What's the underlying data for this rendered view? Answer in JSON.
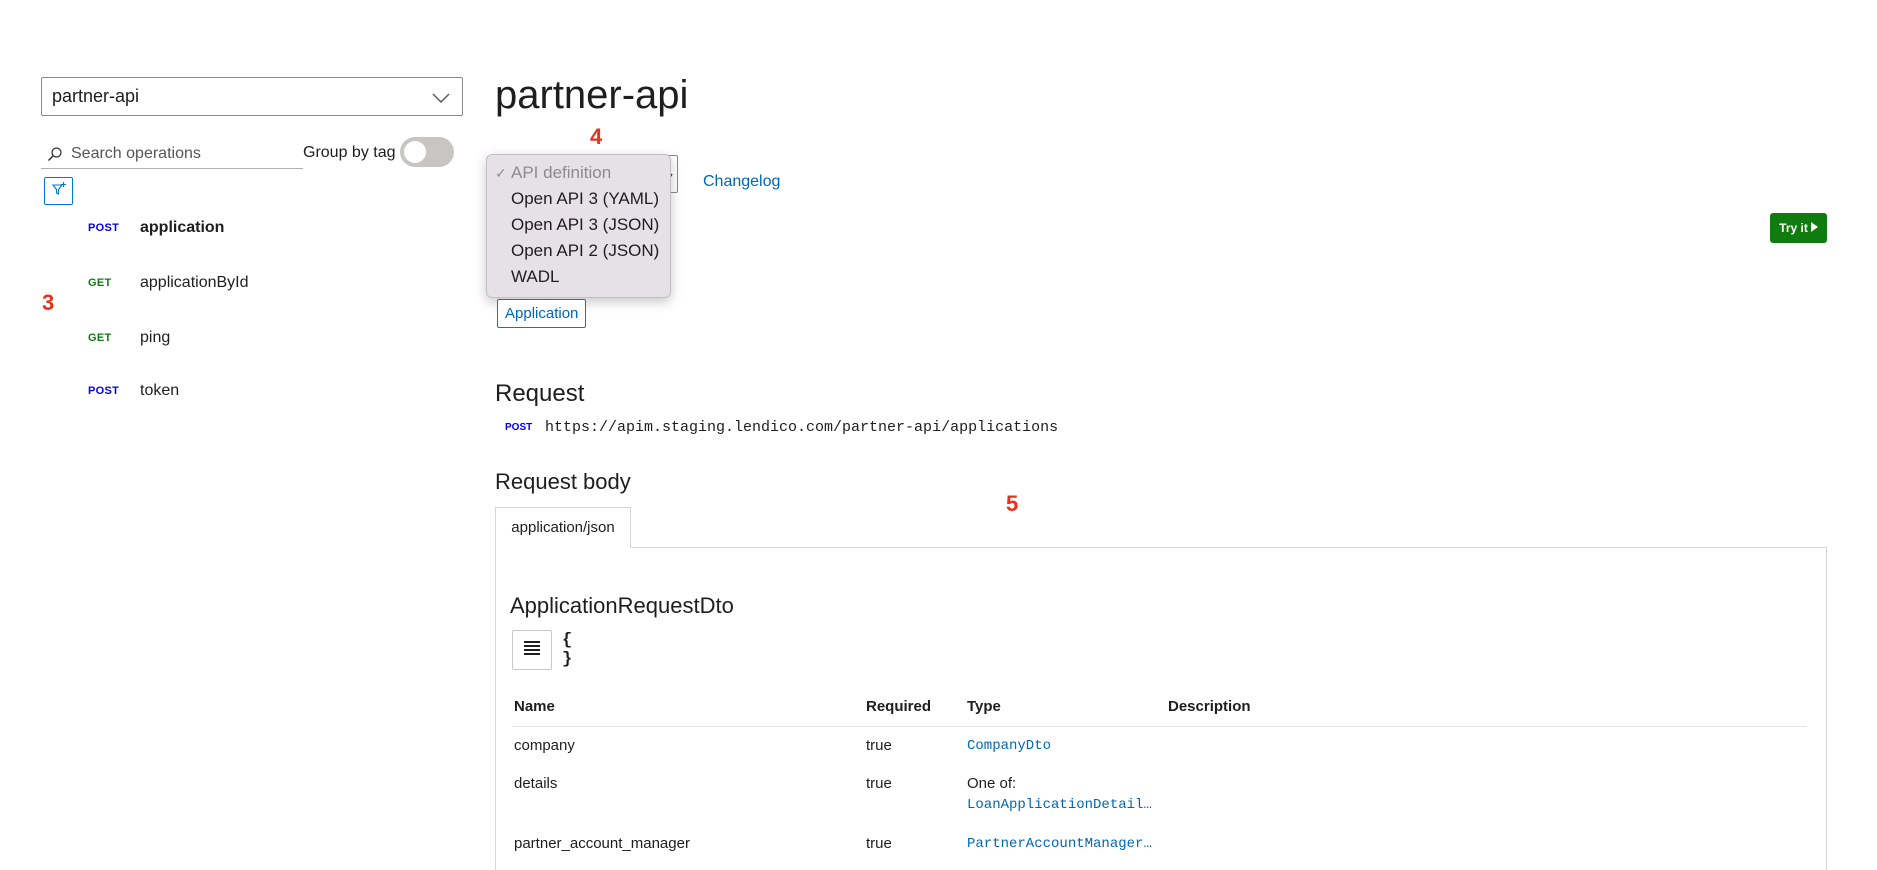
{
  "sidebar": {
    "api_select": {
      "value": "partner-api"
    },
    "search": {
      "placeholder": "Search operations"
    },
    "group_by_tag": {
      "label": "Group by tag",
      "enabled": false
    },
    "operations": [
      {
        "method": "POST",
        "name": "application",
        "active": true
      },
      {
        "method": "GET",
        "name": "applicationById",
        "active": false
      },
      {
        "method": "GET",
        "name": "ping",
        "active": false
      },
      {
        "method": "POST",
        "name": "token",
        "active": false
      }
    ]
  },
  "annotations": {
    "sidebar": "3",
    "dropdown": "4",
    "body": "5"
  },
  "main": {
    "title": "partner-api",
    "definition_dropdown": {
      "options": [
        {
          "label": "API definition",
          "selected": true
        },
        {
          "label": "Open API 3 (YAML)",
          "selected": false
        },
        {
          "label": "Open API 3 (JSON)",
          "selected": false
        },
        {
          "label": "Open API 2 (JSON)",
          "selected": false
        },
        {
          "label": "WADL",
          "selected": false
        }
      ]
    },
    "changelog": "Changelog",
    "try_it": "Try it",
    "tag": "Application",
    "request": {
      "heading": "Request",
      "method": "POST",
      "url": "https://apim.staging.lendico.com/partner-api/applications"
    },
    "request_body": {
      "heading": "Request body",
      "tab": "application/json",
      "schema_title": "ApplicationRequestDto",
      "json_toggle": "{ }",
      "columns": {
        "name": "Name",
        "required": "Required",
        "type": "Type",
        "description": "Description"
      },
      "rows": [
        {
          "name": "company",
          "required": "true",
          "type_prefix": "",
          "type": "CompanyDto"
        },
        {
          "name": "details",
          "required": "true",
          "type_prefix": "One of:",
          "type": "LoanApplicationDetail..."
        },
        {
          "name": "partner_account_manager",
          "required": "true",
          "type_prefix": "",
          "type": "PartnerAccountManager..."
        }
      ]
    }
  },
  "colors": {
    "post": "#0000ee",
    "get": "#107c10",
    "link": "#0067b8",
    "try_button": "#107c10",
    "annotation": "#e8311a"
  },
  "icons": [
    "chevron-down-icon",
    "search-icon",
    "filter-icon",
    "play-icon",
    "table-view-icon",
    "checkmark-icon"
  ]
}
